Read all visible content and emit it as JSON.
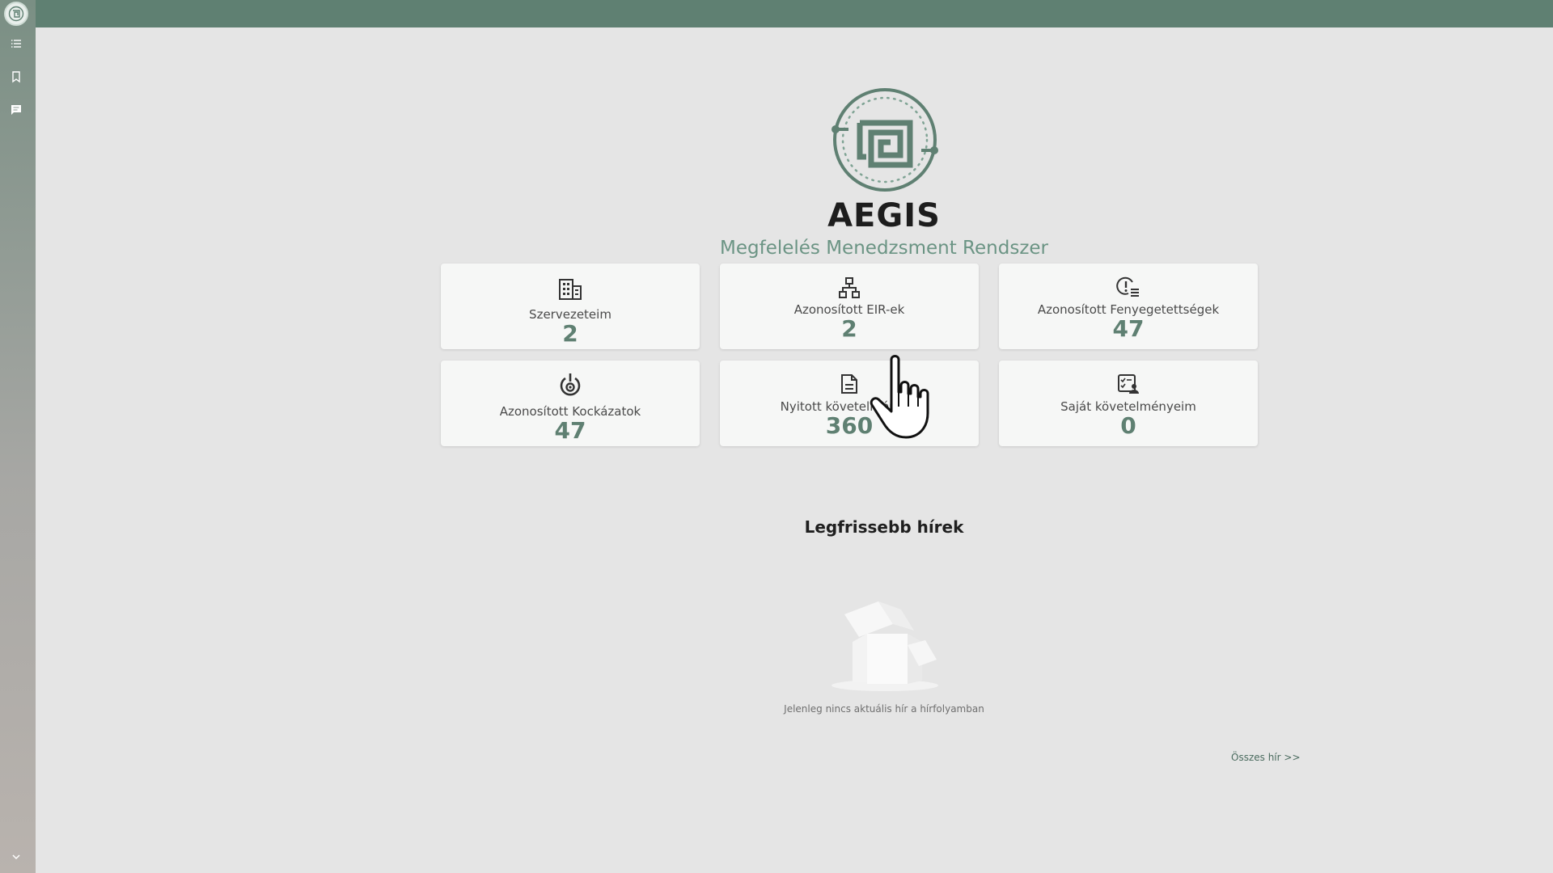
{
  "app": {
    "brand": "AEGIS",
    "tagline": "Megfelelés Menedzsment Rendszer"
  },
  "sidebar": {
    "items": [
      {
        "icon": "list-icon"
      },
      {
        "icon": "bookmark-icon"
      },
      {
        "icon": "chat-icon"
      }
    ],
    "bottom_icon": "chevron-down-icon"
  },
  "cards": [
    {
      "label": "Szervezeteim",
      "value": "2",
      "icon": "building-icon"
    },
    {
      "label": "Azonosított EIR-ek",
      "value": "2",
      "icon": "network-icon"
    },
    {
      "label": "Azonosított Fenyegetettségek",
      "value": "47",
      "icon": "threat-alert-icon"
    },
    {
      "label": "Azonosított Kockázatok",
      "value": "47",
      "icon": "risk-icon"
    },
    {
      "label": "Nyitott követelmények",
      "value": "360",
      "icon": "document-icon"
    },
    {
      "label": "Saját követelményeim",
      "value": "0",
      "icon": "checklist-user-icon"
    }
  ],
  "news": {
    "title": "Legfrissebb hírek",
    "empty_text": "Jelenleg nincs aktuális hír a hírfolyamban",
    "all_link": "Összes hír >>"
  },
  "colors": {
    "accent": "#5f8072",
    "tagline": "#6b9484",
    "background": "#e5e5e5"
  }
}
